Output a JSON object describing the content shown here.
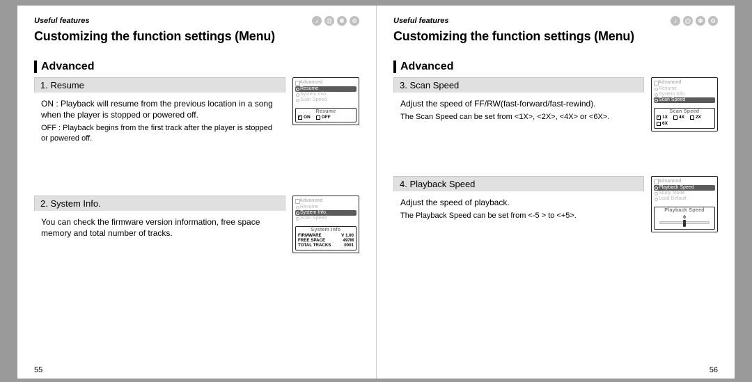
{
  "header": {
    "useful": "Useful features",
    "icons": [
      "music-note-icon",
      "spiral-icon",
      "fan-icon",
      "gear-icon"
    ]
  },
  "title": "Customizing the function settings (Menu)",
  "section": "Advanced",
  "left": {
    "page_num": "55",
    "item1": {
      "title": "1. Resume",
      "body_on": "ON : Playback will resume from the previous location in a song when the player is stopped or powered off.",
      "body_off": "OFF : Playback begins from the first track after the player is stopped or powered off.",
      "device": {
        "head": "Advanced",
        "rows": [
          "Resume",
          "System Info.",
          "Scan Speed"
        ],
        "selected_index": 0,
        "panel_title": "Resume",
        "opts": [
          {
            "label": "ON",
            "checked": true
          },
          {
            "label": "OFF",
            "checked": false
          }
        ]
      }
    },
    "item2": {
      "title": "2. System Info.",
      "body": "You can check the firmware version information, free space memory and total number of tracks.",
      "device": {
        "head": "Advanced",
        "rows": [
          "Resume",
          "System Info.",
          "Scan Speed"
        ],
        "selected_index": 1,
        "panel_title": "System Info",
        "kv": [
          {
            "k": "FIRMWARE",
            "v": "V 1.00"
          },
          {
            "k": "FREE SPACE",
            "v": "497M"
          },
          {
            "k": "TOTAL TRACKS",
            "v": "0001"
          }
        ]
      }
    }
  },
  "right": {
    "page_num": "56",
    "item3": {
      "title": "3. Scan Speed",
      "body": "Adjust the speed of FF/RW(fast-forward/fast-rewind).",
      "detail": "The Scan Speed can be set from <1X>, <2X>, <4X> or <6X>.",
      "device": {
        "head": "Advanced",
        "rows": [
          "Resume",
          "System Info.",
          "Scan Speed"
        ],
        "selected_index": 2,
        "panel_title": "Scan Speed",
        "opts": [
          {
            "label": "1X",
            "checked": true
          },
          {
            "label": "4X",
            "checked": false
          },
          {
            "label": "2X",
            "checked": false
          },
          {
            "label": "6X",
            "checked": false
          }
        ]
      }
    },
    "item4": {
      "title": "4. Playback Speed",
      "body": "Adjust the speed of playback.",
      "detail": "The Playback Speed can be set from <-5 > to <+5>.",
      "device": {
        "head": "Advanced",
        "rows": [
          "Playback Speed",
          "Study Mode",
          "Load Default"
        ],
        "selected_index": 0,
        "panel_title": "Playback Speed",
        "slider_value": "0"
      }
    }
  }
}
